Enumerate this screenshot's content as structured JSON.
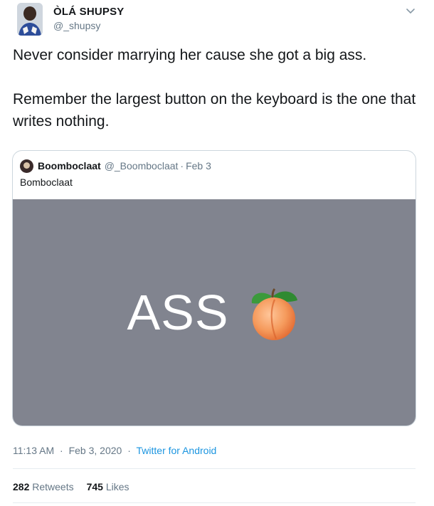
{
  "author": {
    "display_name": "ÒLÁ SHUPSY",
    "handle": "@_shupsy"
  },
  "tweet": {
    "paragraphs": [
      "Never consider marrying her cause she got a big ass.",
      "Remember the largest button on the keyboard is the one that writes nothing."
    ]
  },
  "quoted_tweet": {
    "display_name": "Boomboclaat",
    "handle": "@_Boomboclaat",
    "separator": "·",
    "date": "Feb 3",
    "text": "Bomboclaat",
    "media_text": "ASS",
    "media_emoji": "peach-emoji",
    "media_bg_color": "#81848f"
  },
  "meta": {
    "time": "11:13 AM",
    "separator": "·",
    "date": "Feb 3, 2020",
    "source": "Twitter for Android"
  },
  "stats": {
    "retweets_count": "282",
    "retweets_label": "Retweets",
    "likes_count": "745",
    "likes_label": "Likes"
  },
  "colors": {
    "link": "#1b95e0",
    "secondary_text": "#657786",
    "border": "#ccd6dd"
  }
}
